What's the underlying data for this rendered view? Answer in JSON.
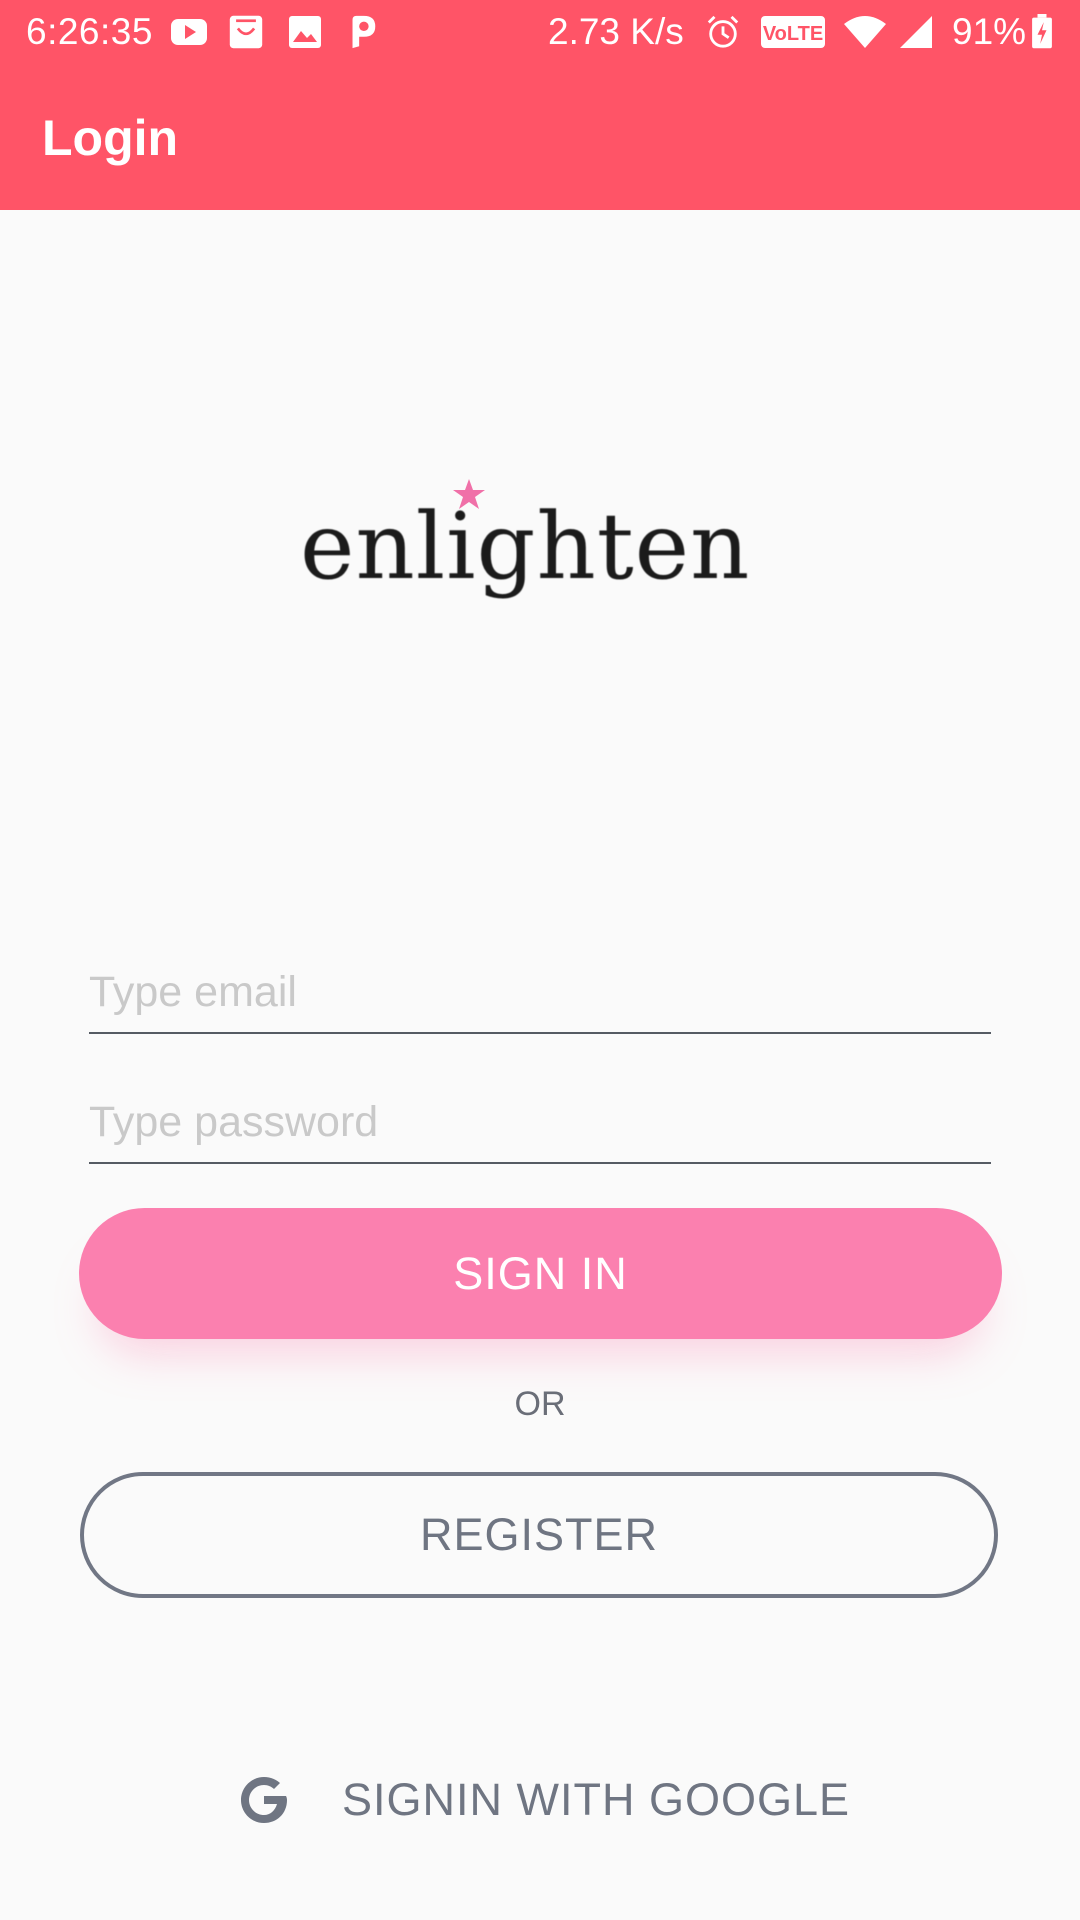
{
  "status_bar": {
    "time": "6:26:35",
    "net_speed": "2.73 K/s",
    "battery": "91%",
    "icons": [
      "youtube-icon",
      "bag-icon",
      "gallery-icon",
      "paytm-icon",
      "alarm-icon",
      "volte-icon",
      "wifi-icon",
      "signal-icon",
      "battery-charging-icon"
    ]
  },
  "app_bar": {
    "title": "Login"
  },
  "logo": {
    "text": "enlighten"
  },
  "form": {
    "email_placeholder": "Type email",
    "email_value": "",
    "password_placeholder": "Type password",
    "password_value": ""
  },
  "buttons": {
    "sign_in": "SIGN IN",
    "or": "OR",
    "register": "REGISTER",
    "google": "SIGNIN WITH GOOGLE"
  },
  "colors": {
    "app_bar": "#ff5467",
    "primary_button": "#fb80af",
    "outline": "#717785",
    "background": "#fafafa"
  }
}
